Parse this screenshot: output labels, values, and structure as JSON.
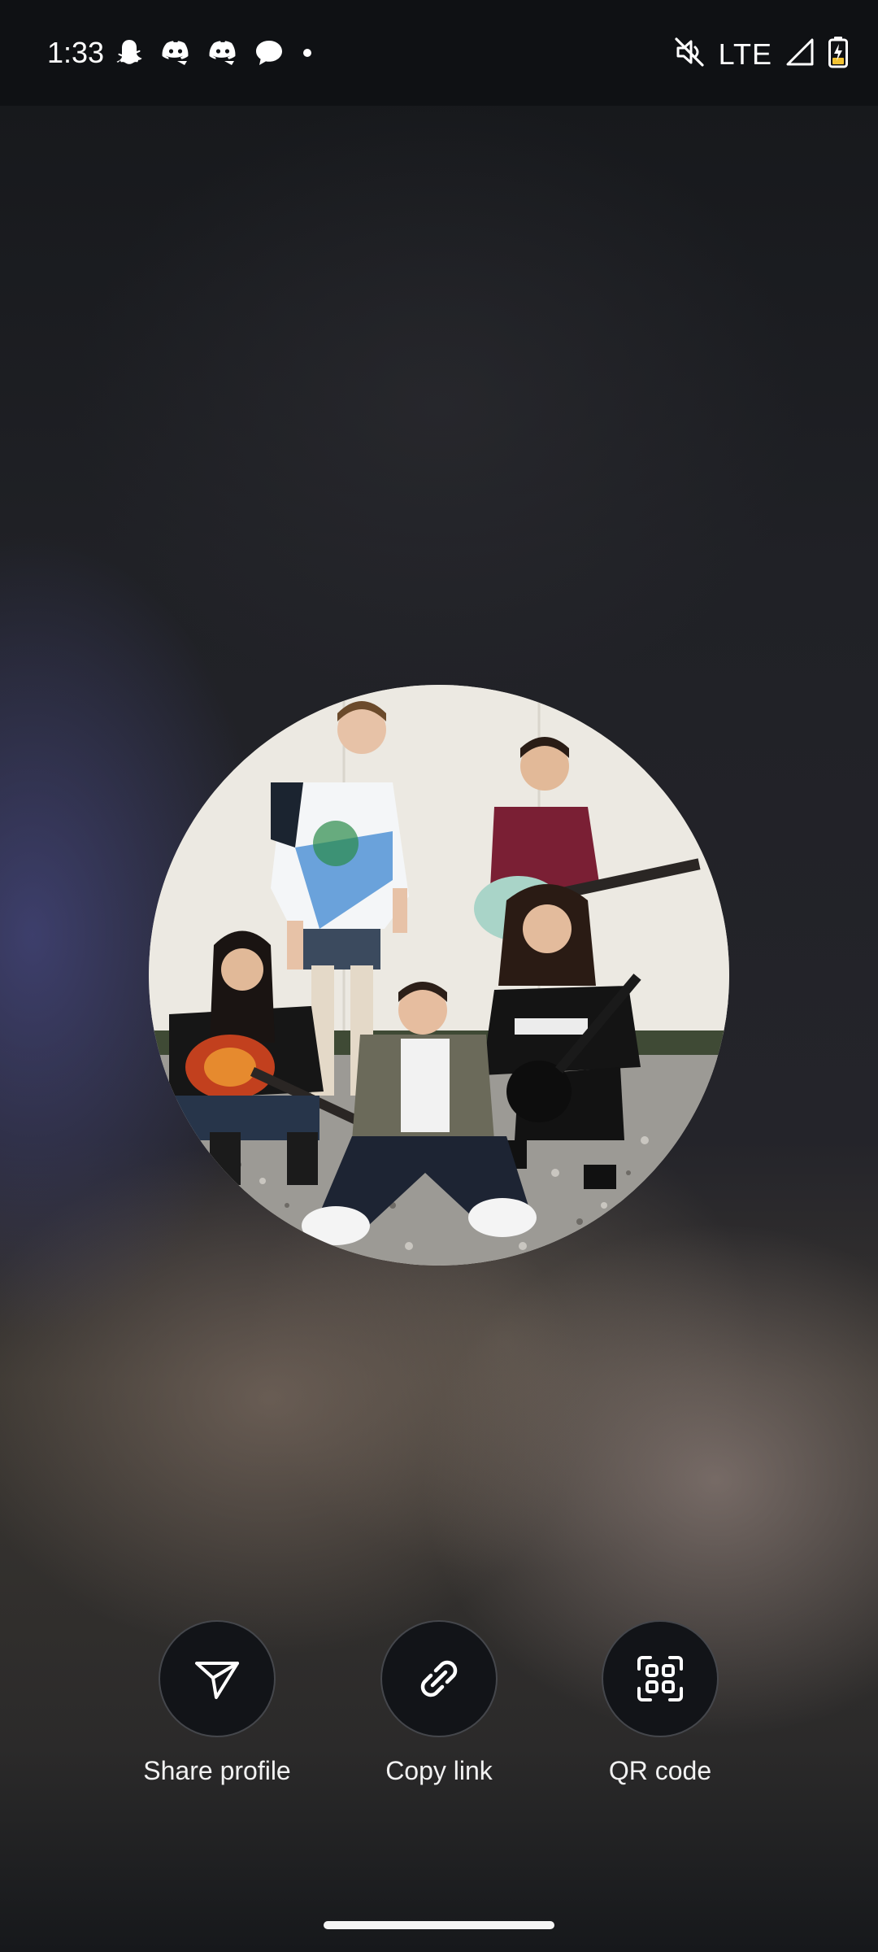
{
  "status_bar": {
    "time": "1:33",
    "network": "LTE",
    "left_icons": [
      "snapchat-icon",
      "discord-icon",
      "discord-icon",
      "messages-icon",
      "more-notifications-dot-icon"
    ],
    "right_icons": [
      "mute-icon",
      "signal-icon",
      "battery-charging-icon"
    ]
  },
  "profile": {
    "photo": "band-group-photo"
  },
  "actions": {
    "share_label": "Share profile",
    "copy_label": "Copy link",
    "qr_label": "QR code"
  },
  "colors": {
    "button_bg": "#121418",
    "button_border": "#45474c",
    "text": "#ffffff"
  }
}
